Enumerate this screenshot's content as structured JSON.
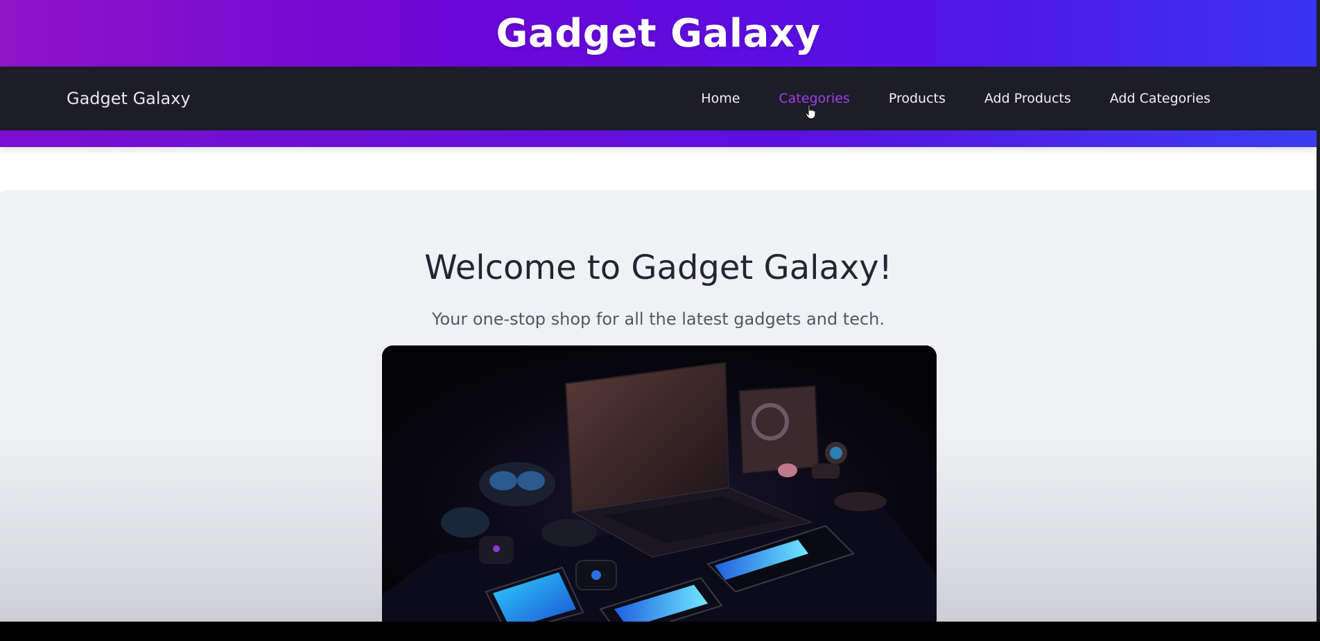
{
  "banner": {
    "title": "Gadget Galaxy"
  },
  "navbar": {
    "brand": "Gadget Galaxy",
    "links": [
      {
        "label": "Home",
        "active": false
      },
      {
        "label": "Categories",
        "active": true
      },
      {
        "label": "Products",
        "active": false
      },
      {
        "label": "Add Products",
        "active": false
      },
      {
        "label": "Add Categories",
        "active": false
      }
    ]
  },
  "hero": {
    "title": "Welcome to Gadget Galaxy!",
    "subtitle": "Your one-stop shop for all the latest gadgets and tech.",
    "image_icon": "gadgets-photo"
  },
  "colors": {
    "accent": "#a23ee6",
    "banner_gradient_start": "#8f14c8",
    "banner_gradient_end": "#3a34f2",
    "navbar_bg": "#1d1c29"
  }
}
